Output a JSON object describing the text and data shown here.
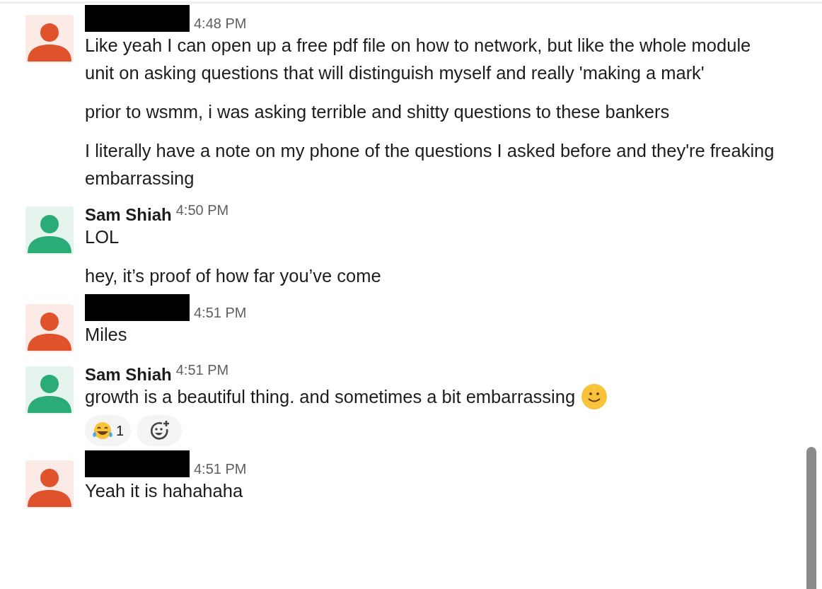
{
  "messages": [
    {
      "redacted": true,
      "color": "#e0522b",
      "time": "4:48 PM",
      "paragraphs": [
        {
          "text": "Like yeah I can open up a free pdf file on how to network, but like the whole module unit on asking questions that will distinguish myself and really 'making a mark'"
        },
        {
          "text": "prior to wsmm, i was asking terrible and shitty questions to these bankers"
        },
        {
          "text": "I literally have a note on my phone of the questions I asked before and they're freaking embarrassing"
        }
      ]
    },
    {
      "redacted": false,
      "author": "Sam Shiah",
      "color": "#2bac76",
      "time": "4:50 PM",
      "paragraphs": [
        {
          "text": "LOL"
        },
        {
          "text": "hey, it’s proof of how far you’ve come"
        }
      ]
    },
    {
      "redacted": true,
      "color": "#e0522b",
      "time": "4:51 PM",
      "paragraphs": [
        {
          "text": "Miles"
        }
      ]
    },
    {
      "redacted": false,
      "author": "Sam Shiah",
      "color": "#2bac76",
      "time": "4:51 PM",
      "paragraphs": [
        {
          "text": "growth is a beautiful thing. and sometimes a bit embarrassing",
          "trailing_emoji": true
        }
      ],
      "reactions": [
        {
          "count": "1"
        }
      ],
      "add_reaction": true
    },
    {
      "redacted": true,
      "color": "#e0522b",
      "time": "4:51 PM",
      "paragraphs": [
        {
          "text": "Yeah it is hahahaha"
        }
      ]
    }
  ]
}
